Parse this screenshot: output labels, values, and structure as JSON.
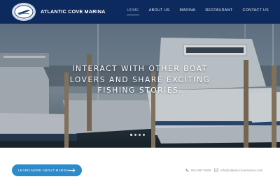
{
  "header": {
    "brand": "ATLANTIC COVE MARINA",
    "nav": [
      "HOME",
      "ABOUT US",
      "MARINA",
      "RESTAURANT",
      "CONTACT US"
    ],
    "active_nav": "HOME"
  },
  "hero": {
    "line1": "INTERACT WITH OTHER BOAT",
    "line2": "LOVERS AND SHARE EXCITING",
    "line3": "FISHING STORIES.",
    "slide_count": 4
  },
  "cta": {
    "label": "LEARN MORE ABOUT MARINA"
  },
  "contact": {
    "phone": "912-867-5309",
    "email": "info@atlanticcovemarina.com"
  },
  "colors": {
    "header": "#0d2a5e",
    "accent": "#2e8bc9"
  },
  "icons": [
    "logo",
    "phone-icon",
    "email-icon",
    "arrow-right-icon"
  ]
}
